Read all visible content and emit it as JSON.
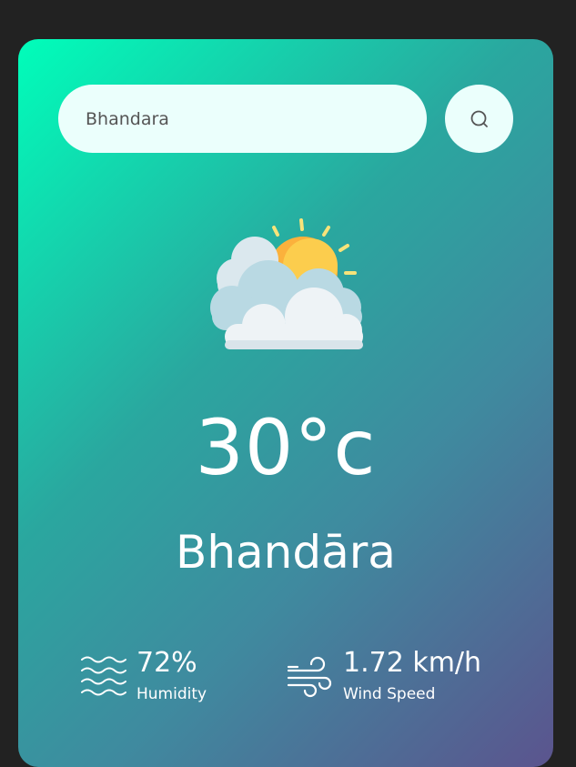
{
  "search": {
    "value": "Bhandara",
    "icon": "search-icon"
  },
  "weather": {
    "icon": "partly-cloudy-sun-icon",
    "temperature": "30°c",
    "city": "Bhandāra"
  },
  "details": {
    "humidity": {
      "value": "72%",
      "label": "Humidity",
      "icon": "humidity-waves-icon"
    },
    "wind": {
      "value": "1.72 km/h",
      "label": "Wind Speed",
      "icon": "wind-icon"
    }
  },
  "colors": {
    "page_bg": "#222222",
    "gradient_start": "#00feba",
    "gradient_end": "#5b548e",
    "input_bg": "#ebfffc"
  }
}
